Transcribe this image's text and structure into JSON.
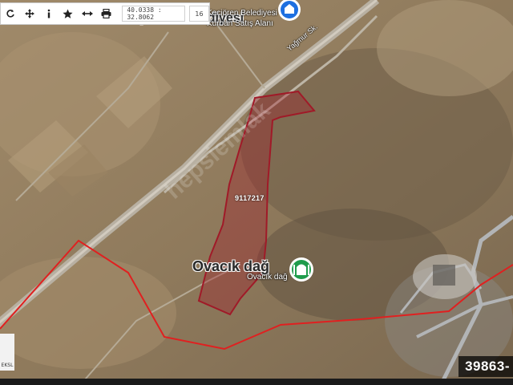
{
  "toolbar": {
    "buttons": [
      {
        "icon": "refresh-icon"
      },
      {
        "icon": "move-icon"
      },
      {
        "icon": "info-icon"
      },
      {
        "icon": "star-icon"
      },
      {
        "icon": "measure-icon"
      },
      {
        "icon": "print-icon"
      }
    ],
    "coordinates": "40.0338 : 32.8062",
    "zoom": "16"
  },
  "map": {
    "top_place_big": "Keçiören Belediyesi",
    "top_place_small": "Keçiören Belediyesi",
    "top_place_small_2": "Kurban Satış Alanı",
    "street": "Yağmur Sk.",
    "parcel": "9117217",
    "place_big": "Ovacık dağ",
    "place_small": "Ovacık dağ",
    "watermark": "hepsiemlak",
    "scale": "EKSL",
    "listing_id": "39863-"
  },
  "colors": {
    "parcel": "#a01a28",
    "boundary": "#e02020",
    "marker_green": "#1f9c4c",
    "marker_blue": "#1d6fe0"
  }
}
